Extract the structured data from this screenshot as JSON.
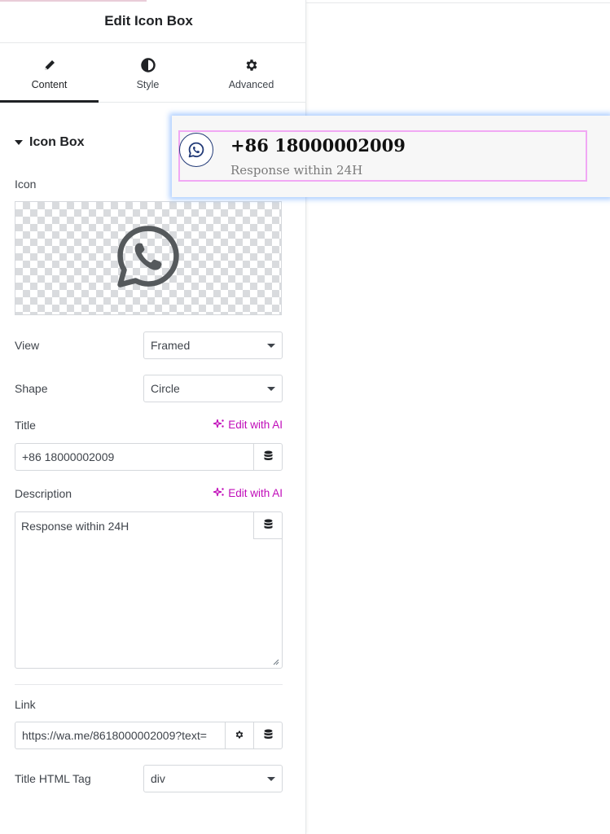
{
  "panel": {
    "title": "Edit Icon Box",
    "tabs": [
      {
        "label": "Content",
        "icon": "pencil-icon",
        "active": true
      },
      {
        "label": "Style",
        "icon": "half-circle-icon",
        "active": false
      },
      {
        "label": "Advanced",
        "icon": "gear-icon",
        "active": false
      }
    ],
    "section": "Icon Box",
    "fields": {
      "icon_label": "Icon",
      "icon_value": "whatsapp-icon",
      "view_label": "View",
      "view_value": "Framed",
      "shape_label": "Shape",
      "shape_value": "Circle",
      "title_label": "Title",
      "title_value": "+86 18000002009",
      "edit_ai": "Edit with AI",
      "description_label": "Description",
      "description_value": "Response within 24H",
      "link_label": "Link",
      "link_value": "https://wa.me/8618000002009?text=",
      "title_tag_label": "Title HTML Tag",
      "title_tag_value": "div"
    }
  },
  "preview": {
    "title": "+86 18000002009",
    "description": "Response within 24H",
    "icon": "whatsapp-icon"
  },
  "colors": {
    "accent_ai": "#c00bb9",
    "selection_border": "#f1a8f4",
    "icon_frame": "#223a77",
    "highlight_glow": "#5096ff"
  }
}
